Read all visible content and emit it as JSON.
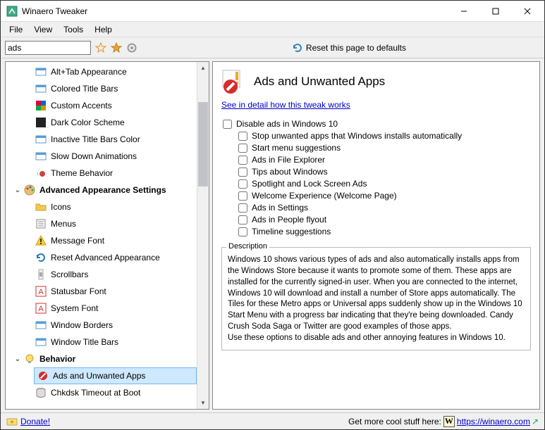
{
  "window": {
    "title": "Winaero Tweaker"
  },
  "menubar": [
    "File",
    "View",
    "Tools",
    "Help"
  ],
  "toolbar": {
    "search_value": "ads",
    "reset_label": "Reset this page to defaults"
  },
  "tree": {
    "items": [
      {
        "type": "item",
        "label": "Alt+Tab Appearance",
        "icon": "window"
      },
      {
        "type": "item",
        "label": "Colored Title Bars",
        "icon": "window"
      },
      {
        "type": "item",
        "label": "Custom Accents",
        "icon": "accents"
      },
      {
        "type": "item",
        "label": "Dark Color Scheme",
        "icon": "dark"
      },
      {
        "type": "item",
        "label": "Inactive Title Bars Color",
        "icon": "window"
      },
      {
        "type": "item",
        "label": "Slow Down Animations",
        "icon": "window"
      },
      {
        "type": "item",
        "label": "Theme Behavior",
        "icon": "theme"
      },
      {
        "type": "category",
        "label": "Advanced Appearance Settings",
        "icon": "palette"
      },
      {
        "type": "item",
        "label": "Icons",
        "icon": "folder"
      },
      {
        "type": "item",
        "label": "Menus",
        "icon": "menus"
      },
      {
        "type": "item",
        "label": "Message Font",
        "icon": "warn"
      },
      {
        "type": "item",
        "label": "Reset Advanced Appearance",
        "icon": "reset"
      },
      {
        "type": "item",
        "label": "Scrollbars",
        "icon": "scroll"
      },
      {
        "type": "item",
        "label": "Statusbar Font",
        "icon": "font"
      },
      {
        "type": "item",
        "label": "System Font",
        "icon": "font"
      },
      {
        "type": "item",
        "label": "Window Borders",
        "icon": "window"
      },
      {
        "type": "item",
        "label": "Window Title Bars",
        "icon": "window"
      },
      {
        "type": "category",
        "label": "Behavior",
        "icon": "bulb"
      },
      {
        "type": "item",
        "label": "Ads and Unwanted Apps",
        "icon": "block",
        "selected": true
      },
      {
        "type": "item",
        "label": "Chkdsk Timeout at Boot",
        "icon": "disk"
      }
    ]
  },
  "detail": {
    "title": "Ads and Unwanted Apps",
    "link": "See in detail how this tweak works",
    "main_check": "Disable ads in Windows 10",
    "sub_checks": [
      "Stop unwanted apps that Windows installs automatically",
      "Start menu suggestions",
      "Ads in File Explorer",
      "Tips about Windows",
      "Spotlight and Lock Screen Ads",
      "Welcome Experience (Welcome Page)",
      "Ads in Settings",
      "Ads in People flyout",
      "Timeline suggestions"
    ],
    "desc_label": "Description",
    "desc_text1": "Windows 10 shows various types of ads and also automatically installs apps from the Windows Store because it wants to promote some of them. These apps are installed for the currently signed-in user. When you are connected to the internet, Windows 10 will download and install a number of Store apps automatically. The Tiles for these Metro apps or Universal apps suddenly show up in the Windows 10 Start Menu with a progress bar indicating that they're being downloaded. Candy Crush Soda Saga or Twitter are good examples of those apps.",
    "desc_text2": "Use these options to disable ads and other annoying features in Windows 10."
  },
  "statusbar": {
    "donate": "Donate!",
    "promo_prefix": "Get more cool stuff here: ",
    "promo_link_text": "https://winaero.com",
    "promo_link_icon": "↗"
  }
}
